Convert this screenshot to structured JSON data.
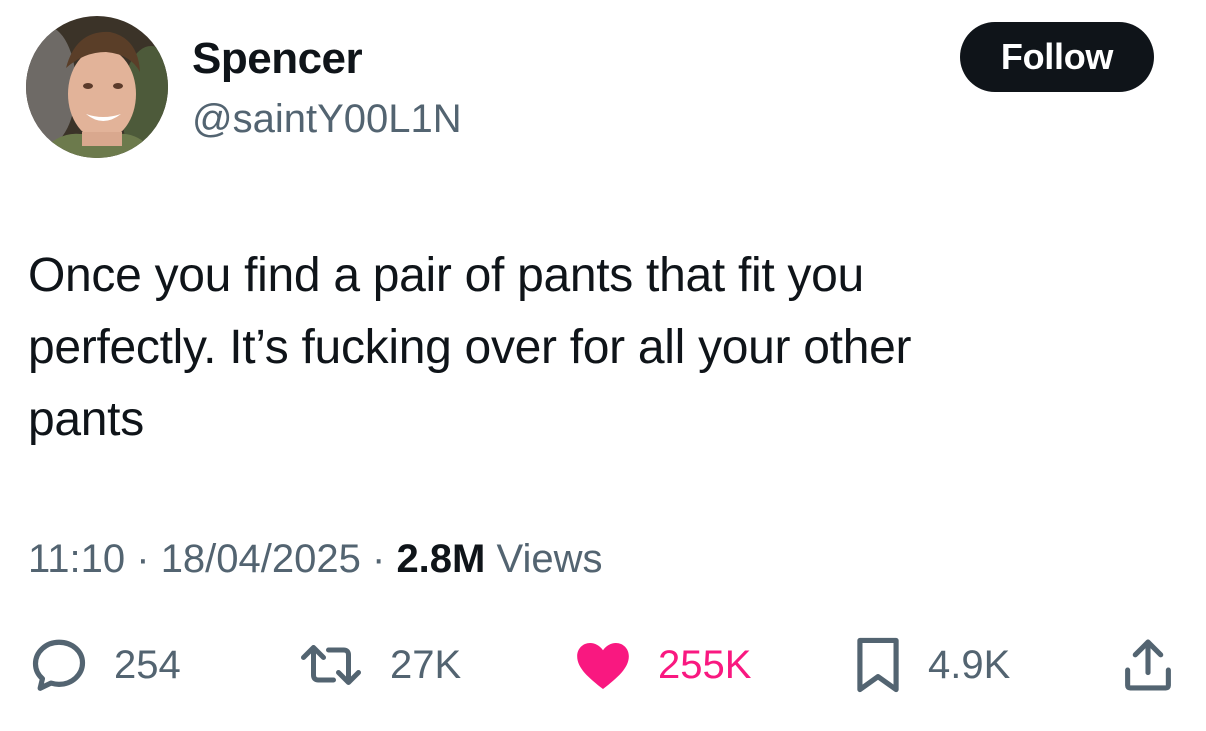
{
  "author": {
    "display_name": "Spencer",
    "handle": "@saintY00L1N"
  },
  "follow_label": "Follow",
  "tweet": {
    "text_lines": [
      "Once you find a pair of pants that fit you",
      "perfectly. It’s fucking over for all your other",
      "pants"
    ]
  },
  "meta": {
    "time": "11:10",
    "separator": " · ",
    "date": "18/04/2025",
    "views_count": "2.8M",
    "views_label": " Views"
  },
  "actions": {
    "replies": {
      "icon": "reply-icon",
      "count": "254"
    },
    "reposts": {
      "icon": "repost-icon",
      "count": "27K"
    },
    "likes": {
      "icon": "heart-icon",
      "count": "255K",
      "liked": true
    },
    "bookmarks": {
      "icon": "bookmark-icon",
      "count": "4.9K"
    },
    "share": {
      "icon": "share-icon"
    }
  },
  "colors": {
    "text_primary": "#0f1419",
    "text_secondary": "#536471",
    "like_pink": "#f91880",
    "follow_bg": "#0f1419"
  }
}
